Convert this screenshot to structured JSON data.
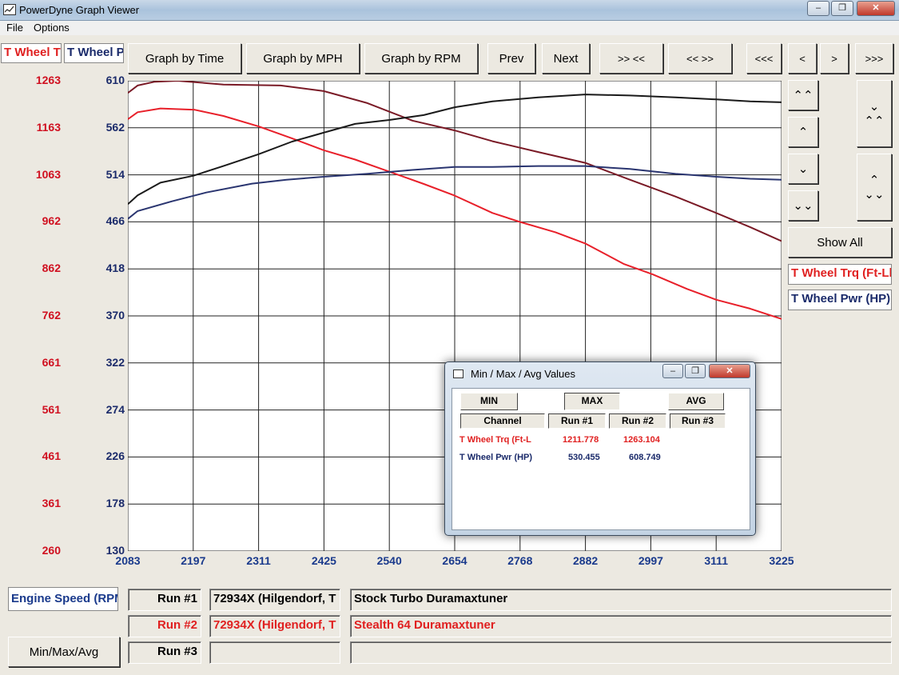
{
  "window": {
    "title": "PowerDyne Graph Viewer"
  },
  "menu": [
    "File",
    "Options"
  ],
  "colors": {
    "run1": "#7a1a26",
    "run2": "#e8202a",
    "trq_label": "#d01020",
    "pwr_label": "#1a2a6a",
    "hp_run1": "#1a1a1a",
    "hp_run2": "#2a3570"
  },
  "tabs": {
    "trq": "T Wheel Trq (Ft-Lbs)",
    "pwr": "T Wheel Pwr (HP)"
  },
  "toolbar": {
    "graph_time": "Graph by Time",
    "graph_mph": "Graph by MPH",
    "graph_rpm": "Graph by RPM",
    "prev": "Prev",
    "next": "Next",
    "zoom_in": ">> <<",
    "zoom_out": "<< >>",
    "first": "<<<",
    "left": "<",
    "right": ">",
    "last": ">>>"
  },
  "side": {
    "show_all": "Show All",
    "channel_trq": "T Wheel Trq (Ft-Lbs)",
    "channel_pwr": "T Wheel Pwr (HP)"
  },
  "chart_data": {
    "type": "line",
    "x_ticks": [
      "2083",
      "2197",
      "2311",
      "2425",
      "2540",
      "2654",
      "2768",
      "2882",
      "2997",
      "3111",
      "3225"
    ],
    "xlim": [
      2083,
      3225
    ],
    "y_left_ticks": [
      "1263",
      "1163",
      "1063",
      "962",
      "862",
      "762",
      "661",
      "561",
      "461",
      "361",
      "260"
    ],
    "y_left_lim": [
      260,
      1263
    ],
    "y_right_ticks": [
      "610",
      "562",
      "514",
      "466",
      "418",
      "370",
      "322",
      "274",
      "226",
      "178",
      "130"
    ],
    "y_right_lim": [
      130,
      610
    ],
    "grid": true,
    "series": [
      {
        "axis": "left",
        "color": "#7a1a26",
        "x": [
          2083,
          2100,
          2130,
          2170,
          2250,
          2350,
          2425,
          2500,
          2580,
          2654,
          2720,
          2800,
          2882,
          2960,
          3040,
          3111,
          3170,
          3225
        ],
        "y": [
          1237,
          1253,
          1261,
          1263,
          1255,
          1253,
          1241,
          1216,
          1178,
          1157,
          1134,
          1111,
          1088,
          1052,
          1016,
          981,
          951,
          921
        ]
      },
      {
        "axis": "left",
        "color": "#e8202a",
        "x": [
          2083,
          2100,
          2140,
          2200,
          2250,
          2311,
          2370,
          2425,
          2480,
          2540,
          2600,
          2654,
          2720,
          2768,
          2830,
          2882,
          2950,
          3000,
          3060,
          3111,
          3170,
          3225
        ],
        "y": [
          1181,
          1196,
          1204,
          1201,
          1188,
          1166,
          1140,
          1115,
          1095,
          1069,
          1043,
          1018,
          981,
          962,
          940,
          916,
          872,
          850,
          819,
          796,
          777,
          755
        ]
      },
      {
        "axis": "right",
        "color": "#1a1a1a",
        "x": [
          2083,
          2100,
          2140,
          2197,
          2250,
          2311,
          2370,
          2425,
          2480,
          2540,
          2600,
          2654,
          2720,
          2800,
          2882,
          2960,
          3040,
          3111,
          3170,
          3225
        ],
        "y": [
          484,
          493,
          506,
          513,
          523,
          535,
          548,
          557,
          566,
          570,
          575,
          583,
          589,
          593,
          596,
          595,
          593,
          591,
          589,
          588
        ]
      },
      {
        "axis": "right",
        "color": "#2a3570",
        "x": [
          2083,
          2100,
          2160,
          2220,
          2300,
          2360,
          2425,
          2500,
          2580,
          2654,
          2720,
          2800,
          2882,
          2960,
          3040,
          3111,
          3170,
          3225
        ],
        "y": [
          469,
          477,
          487,
          496,
          505,
          509,
          512,
          515,
          519,
          522,
          522,
          523,
          523,
          520,
          515,
          512,
          510,
          509
        ]
      }
    ]
  },
  "bottom": {
    "x_channel": "Engine Speed (RPM)",
    "minmax_button": "Min/Max/Avg",
    "runs": [
      {
        "label": "Run #1",
        "file": "72934X (Hilgendorf, T",
        "desc": "Stock Turbo Duramaxtuner",
        "color": "#000000"
      },
      {
        "label": "Run #2",
        "file": "72934X (Hilgendorf, T",
        "desc": "Stealth 64 Duramaxtuner",
        "color": "#e02020"
      },
      {
        "label": "Run #3",
        "file": "",
        "desc": "",
        "color": "#000000"
      }
    ]
  },
  "dialog": {
    "title": "Min / Max / Avg Values",
    "min_btn": "MIN",
    "max_btn": "MAX",
    "avg_btn": "AVG",
    "headers": [
      "Channel",
      "Run #1",
      "Run #2",
      "Run #3"
    ],
    "rows": [
      {
        "channel": "T Wheel Trq (Ft-L",
        "run1": "1211.778",
        "run2": "1263.104",
        "run3": "",
        "color": "#e02020"
      },
      {
        "channel": "T Wheel Pwr (HP)",
        "run1": "530.455",
        "run2": "608.749",
        "run3": "",
        "color": "#1a2a6a"
      }
    ]
  }
}
